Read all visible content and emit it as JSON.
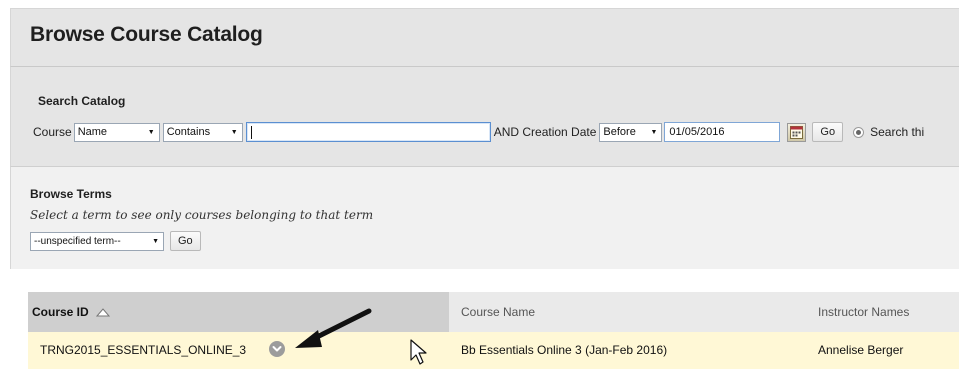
{
  "page": {
    "title": "Browse Course Catalog"
  },
  "search": {
    "heading": "Search Catalog",
    "field_label": "Course",
    "field_select": "Name",
    "operator_select": "Contains",
    "query_value": "",
    "and_label": "AND Creation Date",
    "date_operator": "Before",
    "date_value": "01/05/2016",
    "go_label": "Go",
    "scope_label": "Search thi"
  },
  "terms": {
    "heading": "Browse Terms",
    "hint": "Select a term to see only courses belonging to that term",
    "term_select": "--unspecified term--",
    "go_label": "Go"
  },
  "table": {
    "columns": [
      "Course ID",
      "Course Name",
      "Instructor Names"
    ],
    "rows": [
      {
        "course_id": "TRNG2015_ESSENTIALS_ONLINE_3",
        "course_name": "Bb Essentials Online 3 (Jan-Feb 2016)",
        "instructor": "Annelise Berger"
      }
    ]
  },
  "icons": {
    "calendar": "calendar-icon",
    "sort": "sort-ascending-icon",
    "chevron": "chevron-down-icon",
    "arrow": "annotation-arrow-icon",
    "cursor": "mouse-pointer-icon"
  },
  "colors": {
    "panel_gray": "#e5e5e5",
    "highlight_row": "#fff8d6",
    "sorted_header": "#cfcfcf"
  }
}
